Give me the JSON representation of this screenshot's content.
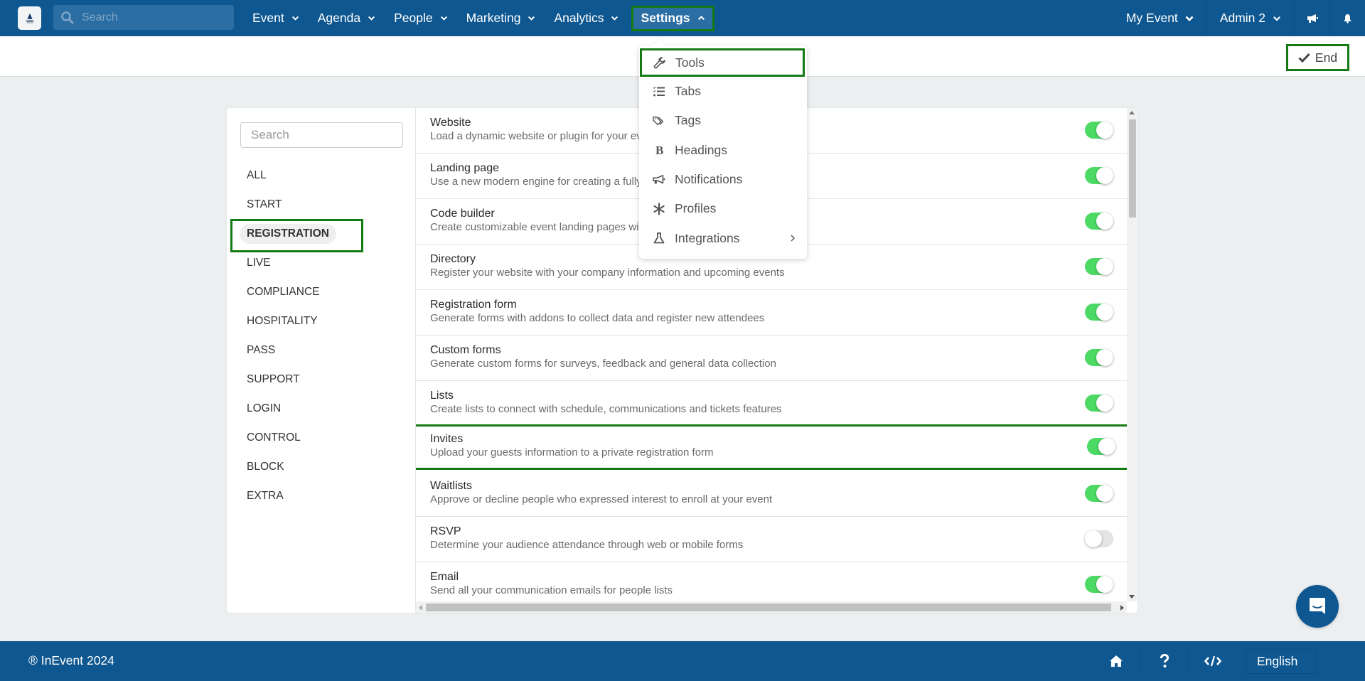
{
  "topbar": {
    "search_placeholder": "Search",
    "nav": [
      {
        "label": "Event",
        "expanded": false
      },
      {
        "label": "Agenda",
        "expanded": false
      },
      {
        "label": "People",
        "expanded": false
      },
      {
        "label": "Marketing",
        "expanded": false
      },
      {
        "label": "Analytics",
        "expanded": false
      },
      {
        "label": "Settings",
        "expanded": true
      }
    ],
    "event_selector": "My Event",
    "user_menu": "Admin 2"
  },
  "subbar": {
    "end_label": "End"
  },
  "settings_menu": {
    "items": [
      {
        "label": "Tools",
        "icon": "wrench-icon"
      },
      {
        "label": "Tabs",
        "icon": "list-check-icon"
      },
      {
        "label": "Tags",
        "icon": "tags-icon"
      },
      {
        "label": "Headings",
        "icon": "bold-icon"
      },
      {
        "label": "Notifications",
        "icon": "megaphone-icon"
      },
      {
        "label": "Profiles",
        "icon": "asterisk-icon"
      },
      {
        "label": "Integrations",
        "icon": "flask-icon",
        "has_submenu": true
      }
    ]
  },
  "sidebar": {
    "search_placeholder": "Search",
    "categories": [
      "ALL",
      "START",
      "REGISTRATION",
      "LIVE",
      "COMPLIANCE",
      "HOSPITALITY",
      "PASS",
      "SUPPORT",
      "LOGIN",
      "CONTROL",
      "BLOCK",
      "EXTRA"
    ],
    "selected": "REGISTRATION"
  },
  "tools": [
    {
      "title": "Website",
      "description": "Load a dynamic website or plugin for your event",
      "enabled": true
    },
    {
      "title": "Landing page",
      "description": "Use a new modern engine for creating a fully customizable event landing pages",
      "enabled": true
    },
    {
      "title": "Code builder",
      "description": "Create customizable event landing pages with code",
      "enabled": true
    },
    {
      "title": "Directory",
      "description": "Register your website with your company information and upcoming events",
      "enabled": true
    },
    {
      "title": "Registration form",
      "description": "Generate forms with addons to collect data and register new attendees",
      "enabled": true
    },
    {
      "title": "Custom forms",
      "description": "Generate custom forms for surveys, feedback and general data collection",
      "enabled": true
    },
    {
      "title": "Lists",
      "description": "Create lists to connect with schedule, communications and tickets features",
      "enabled": true
    },
    {
      "title": "Invites",
      "description": "Upload your guests information to a private registration form",
      "enabled": true
    },
    {
      "title": "Waitlists",
      "description": "Approve or decline people who expressed interest to enroll at your event",
      "enabled": true
    },
    {
      "title": "RSVP",
      "description": "Determine your audience attendance through web or mobile forms",
      "enabled": false
    },
    {
      "title": "Email",
      "description": "Send all your communication emails for people lists",
      "enabled": true
    }
  ],
  "footer": {
    "copyright": "® InEvent 2024",
    "language": "English"
  },
  "colors": {
    "brand": "#0e5790",
    "toggle_on": "#4cd964",
    "highlight": "#137a14"
  }
}
